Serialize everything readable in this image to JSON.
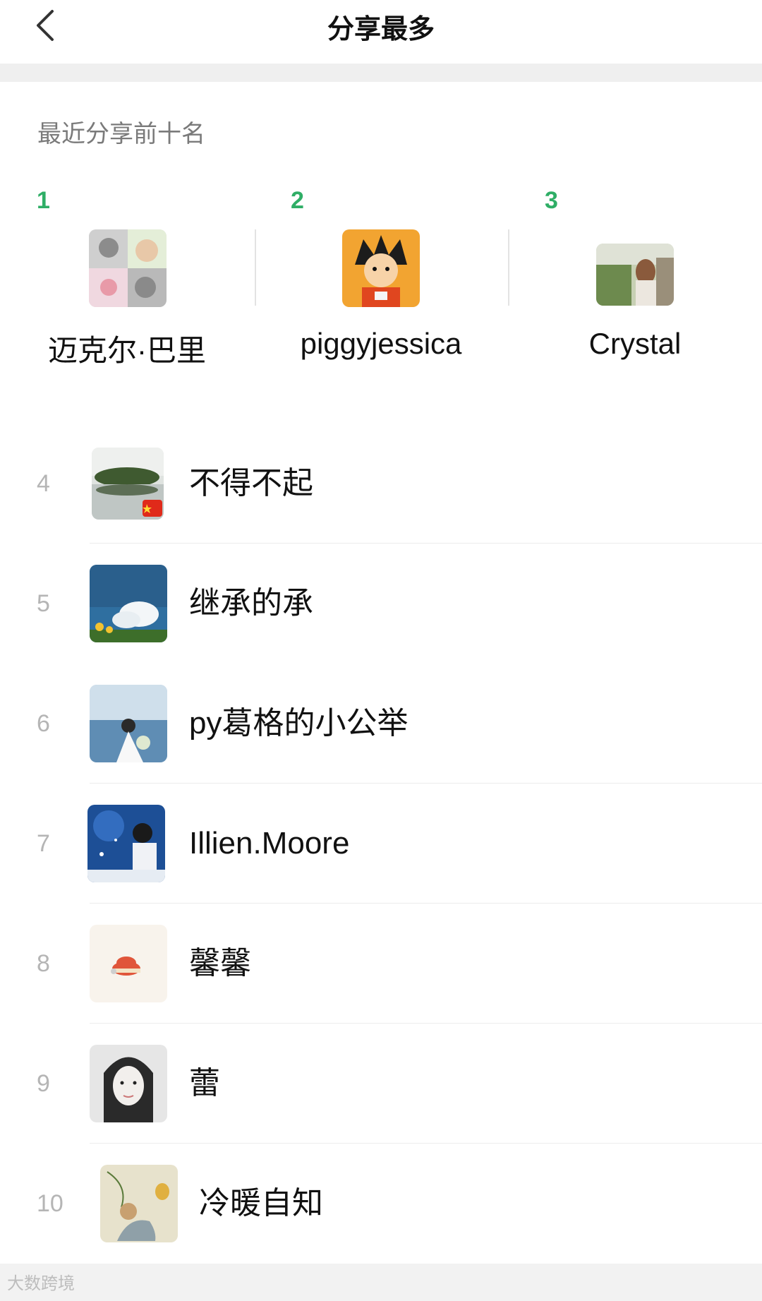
{
  "header": {
    "title": "分享最多"
  },
  "section": {
    "label": "最近分享前十名"
  },
  "top3": [
    {
      "rank": "1",
      "name": "迈克尔·巴里"
    },
    {
      "rank": "2",
      "name": "piggyjessica"
    },
    {
      "rank": "3",
      "name": "Crystal"
    }
  ],
  "list": [
    {
      "rank": "4",
      "name": "不得不起"
    },
    {
      "rank": "5",
      "name": "继承的承"
    },
    {
      "rank": "6",
      "name": "py葛格的小公举"
    },
    {
      "rank": "7",
      "name": "Illien.Moore"
    },
    {
      "rank": "8",
      "name": "馨馨"
    },
    {
      "rank": "9",
      "name": "蕾"
    },
    {
      "rank": "10",
      "name": "冷暖自知"
    }
  ],
  "footer": {
    "watermark": "大数跨境"
  },
  "colors": {
    "rank_green": "#2fae66",
    "rank_gray": "#b5b5b5",
    "separator": "#efefef"
  }
}
